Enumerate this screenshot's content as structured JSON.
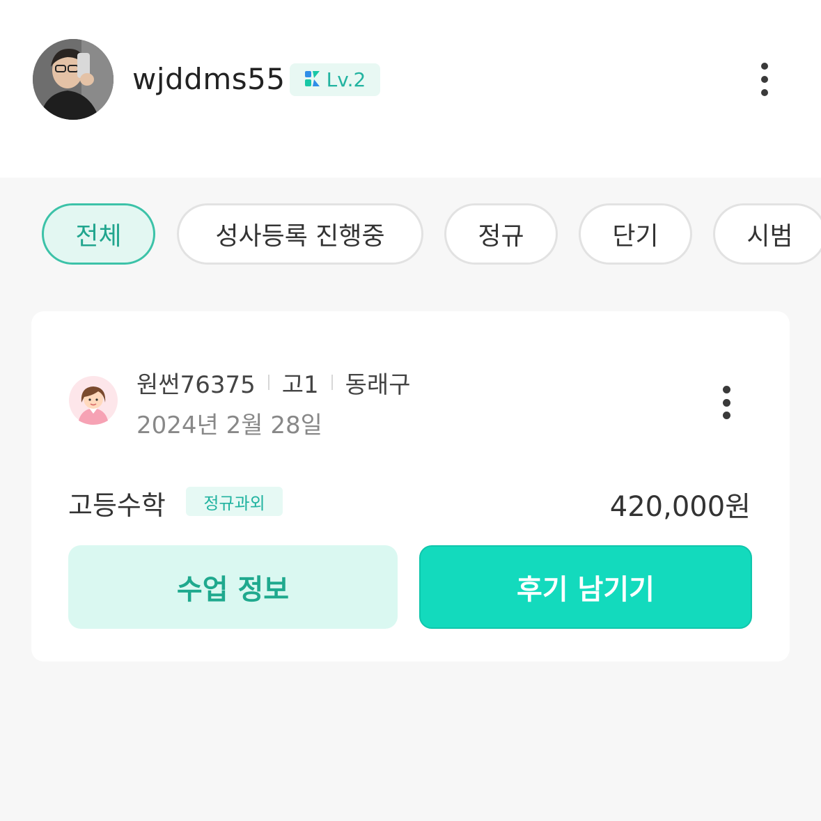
{
  "profile": {
    "username": "wjddms55",
    "level_label": "Lv.2"
  },
  "filters": [
    {
      "label": "전체",
      "active": true
    },
    {
      "label": "성사등록 진행중",
      "active": false
    },
    {
      "label": "정규",
      "active": false
    },
    {
      "label": "단기",
      "active": false
    },
    {
      "label": "시범",
      "active": false
    }
  ],
  "card": {
    "student_name": "원썬76375",
    "grade": "고1",
    "district": "동래구",
    "date": "2024년 2월 28일",
    "subject": "고등수학",
    "class_type": "정규과외",
    "price": "420,000원",
    "info_button": "수업 정보",
    "review_button": "후기 남기기"
  },
  "colors": {
    "accent": "#13dabd",
    "accent_text": "#21b3a0",
    "chip_active_bg": "#e3f7f2"
  },
  "icons": {
    "level_badge": "brand-k-icon",
    "menu": "more-vertical-icon",
    "student": "student-avatar-icon"
  }
}
